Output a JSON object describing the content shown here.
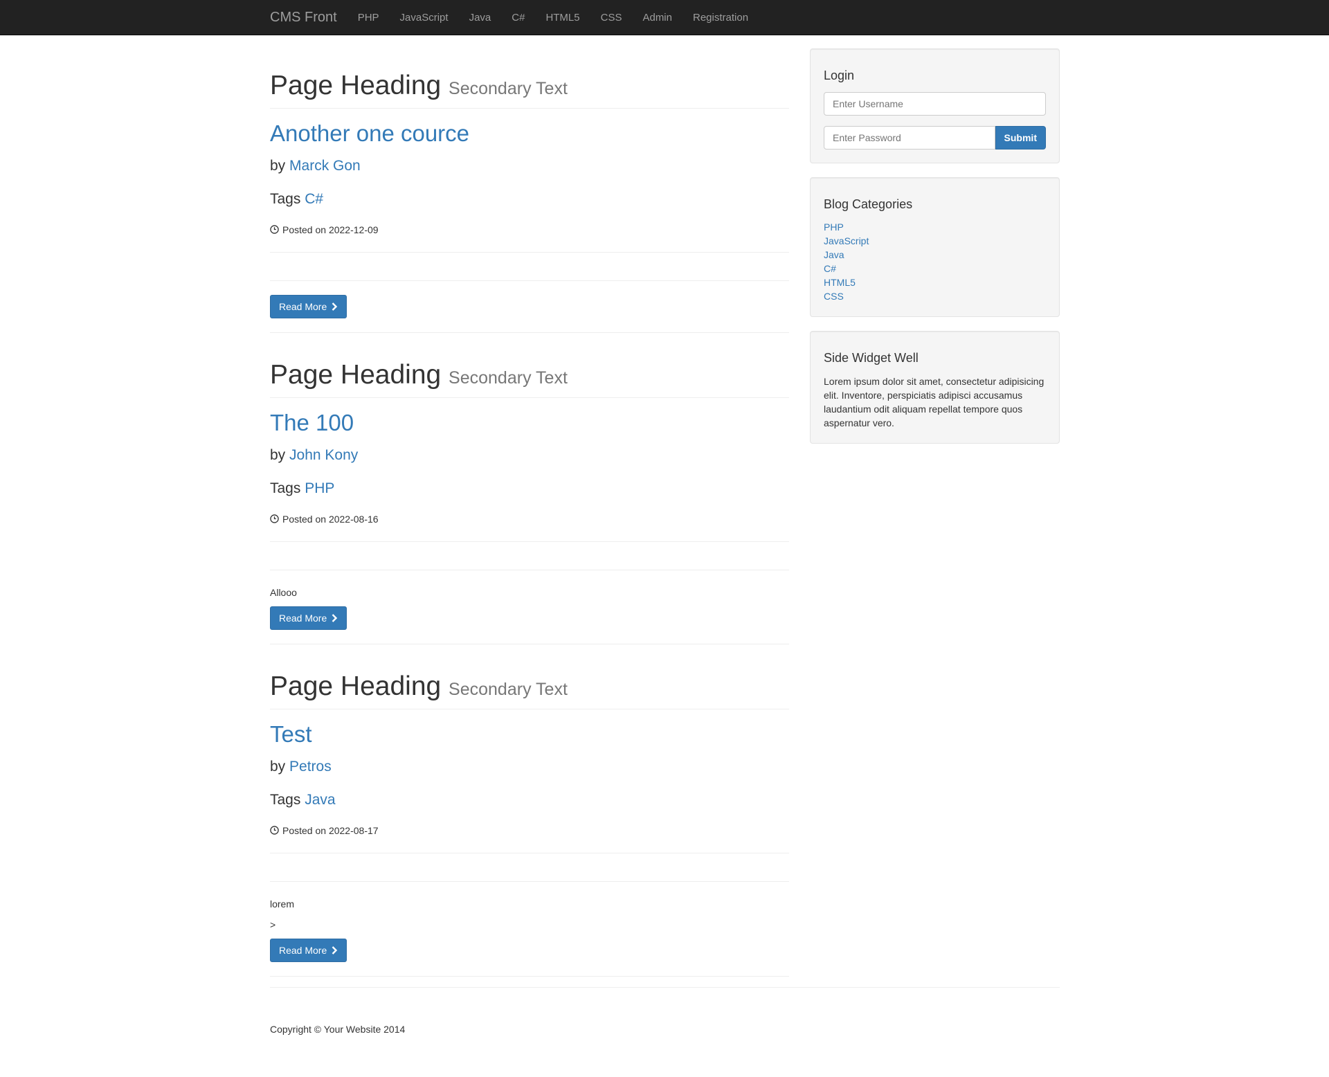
{
  "navbar": {
    "brand": "CMS Front",
    "links": [
      "PHP",
      "JavaScript",
      "Java",
      "C#",
      "HTML5",
      "CSS",
      "Admin",
      "Registration"
    ]
  },
  "posts": [
    {
      "heading": "Page Heading",
      "secondary": "Secondary Text",
      "title": "Another one cource",
      "by_label": "by",
      "author": "Marck Gon",
      "tags_label": "Tags",
      "tag": "C#",
      "posted": "Posted on 2022-12-09",
      "excerpt": "",
      "extra": "",
      "read_more": "Read More"
    },
    {
      "heading": "Page Heading",
      "secondary": "Secondary Text",
      "title": "The 100",
      "by_label": "by",
      "author": "John Kony",
      "tags_label": "Tags",
      "tag": "PHP",
      "posted": "Posted on 2022-08-16",
      "excerpt": "Allooo",
      "extra": "",
      "read_more": "Read More"
    },
    {
      "heading": "Page Heading",
      "secondary": "Secondary Text",
      "title": "Test",
      "by_label": "by",
      "author": "Petros",
      "tags_label": "Tags",
      "tag": "Java",
      "posted": "Posted on 2022-08-17",
      "excerpt": "lorem",
      "extra": ">",
      "read_more": "Read More"
    }
  ],
  "login": {
    "title": "Login",
    "username_placeholder": "Enter Username",
    "password_placeholder": "Enter Password",
    "submit": "Submit"
  },
  "categories": {
    "title": "Blog Categories",
    "items": [
      "PHP",
      "JavaScript",
      "Java",
      "C#",
      "HTML5",
      "CSS"
    ]
  },
  "widget": {
    "title": "Side Widget Well",
    "text": "Lorem ipsum dolor sit amet, consectetur adipisicing elit. Inventore, perspiciatis adipisci accusamus laudantium odit aliquam repellat tempore quos aspernatur vero."
  },
  "footer": {
    "copyright": "Copyright © Your Website 2014"
  },
  "colors": {
    "navbar_bg": "#222222",
    "link": "#337ab7",
    "button": "#337ab7",
    "well_bg": "#f5f5f5"
  }
}
